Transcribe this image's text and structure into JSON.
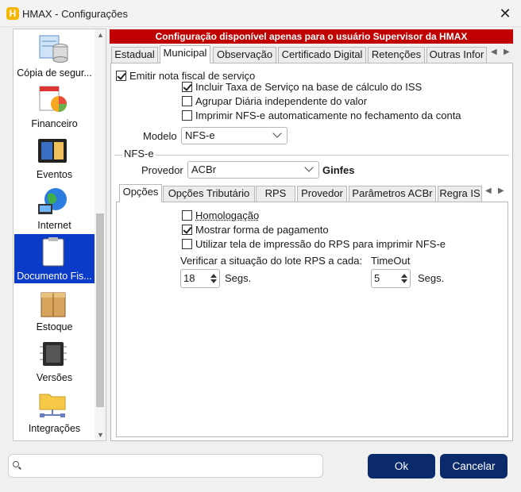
{
  "window": {
    "title": "HMAX - Configurações",
    "app_icon_letter": "H",
    "close_glyph": "✕"
  },
  "sidebar": {
    "items": [
      {
        "label": "Cópia de segur...",
        "icon": "database-icon"
      },
      {
        "label": "Financeiro",
        "icon": "finance-icon"
      },
      {
        "label": "Eventos",
        "icon": "calendar-icon"
      },
      {
        "label": "Internet",
        "icon": "globe-icon"
      },
      {
        "label": "Documento Fis...",
        "icon": "clipboard-icon",
        "selected": true
      },
      {
        "label": "Estoque",
        "icon": "box-icon"
      },
      {
        "label": "Versões",
        "icon": "chip-icon"
      },
      {
        "label": "Integrações",
        "icon": "folder-network-icon"
      }
    ]
  },
  "banner": {
    "text": "Configuração disponível apenas para o usuário Supervisor da HMAX"
  },
  "tabs": [
    "Estadual",
    "Municipal",
    "Observação",
    "Certificado Digital",
    "Retenções",
    "Outras Infor"
  ],
  "municipal": {
    "emitir_label": "Emitir nota fiscal de serviço",
    "emitir_checked": true,
    "incluir_label": "Incluir Taxa de Serviço na base de cálculo do ISS",
    "incluir_checked": true,
    "agrupar_label": "Agrupar Diária independente do valor",
    "agrupar_checked": false,
    "imprimir_label": "Imprimir NFS-e automaticamente no fechamento da conta",
    "imprimir_checked": false,
    "modelo_label": "Modelo",
    "modelo_value": "NFS-e",
    "group_label": "NFS-e",
    "provedor_label": "Provedor",
    "provedor_value": "ACBr",
    "provedor_extra": "Ginfes"
  },
  "subtabs": [
    "Opções",
    "Opções Tributário",
    "RPS",
    "Provedor",
    "Parâmetros ACBr",
    "Regra IS"
  ],
  "opcoes": {
    "homologacao_label": "Homologação",
    "homologacao_checked": false,
    "mostrar_label": "Mostrar forma de pagamento",
    "mostrar_checked": true,
    "utilizar_label": "Utilizar tela de impressão do RPS para imprimir NFS-e",
    "utilizar_checked": false,
    "verificar_label": "Verificar a situação do lote RPS a cada:",
    "verificar_value": "18",
    "verificar_unit": "Segs.",
    "timeout_label": "TimeOut",
    "timeout_value": "5",
    "timeout_unit": "Segs."
  },
  "footer": {
    "search_placeholder": "",
    "ok_label": "Ok",
    "cancel_label": "Cancelar"
  }
}
